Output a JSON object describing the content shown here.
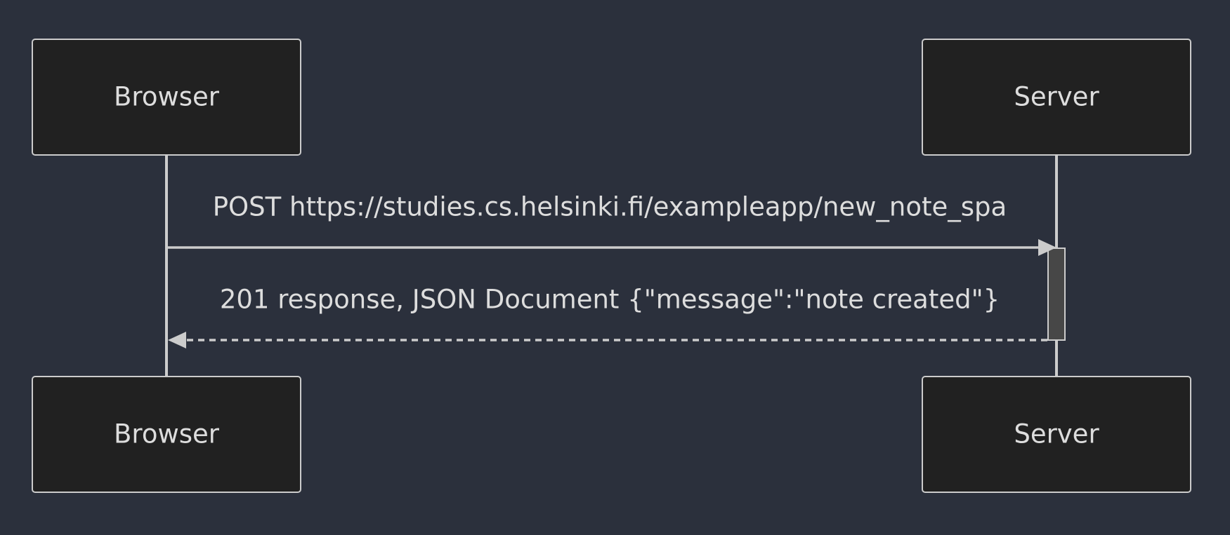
{
  "participants": {
    "browser": "Browser",
    "server": "Server"
  },
  "messages": [
    {
      "from": "Browser",
      "to": "Server",
      "text": "POST https://studies.cs.helsinki.fi/exampleapp/new_note_spa",
      "style": "solid"
    },
    {
      "from": "Server",
      "to": "Browser",
      "text": "201 response, JSON Document {\"message\":\"note created\"}",
      "style": "dashed"
    }
  ],
  "colors": {
    "background": "#2b303c",
    "actor_fill": "#212121",
    "line": "#cccccc",
    "activation_fill": "#474747",
    "text": "#dddddd"
  }
}
